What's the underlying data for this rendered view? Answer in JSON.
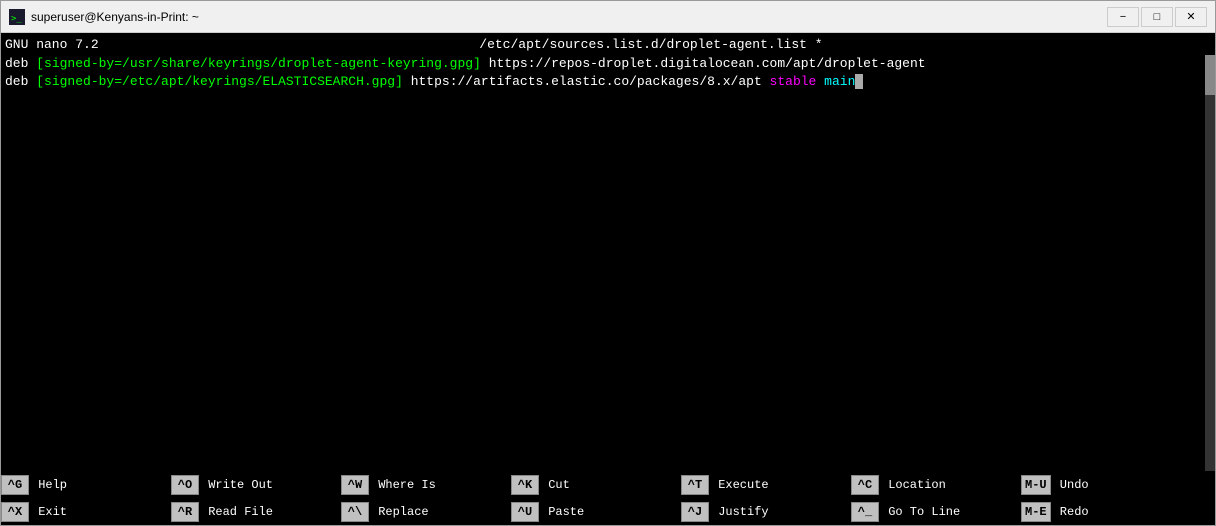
{
  "window": {
    "title": "superuser@Kenyans-in-Print: ~",
    "icon": "terminal-icon"
  },
  "titlebar": {
    "title_text": "superuser@Kenyans-in-Print: ~",
    "minimize_label": "−",
    "maximize_label": "□",
    "close_label": "✕"
  },
  "nano": {
    "header_left": "GNU nano 7.2",
    "header_center": "/etc/apt/sources.list.d/droplet-agent.list *",
    "line1_deb": "deb ",
    "line1_bracket": "[signed-by=/usr/share/keyrings/droplet-agent-keyring.gpg]",
    "line1_url": " https://repos-droplet.digitalocean.com/apt/droplet-agent",
    "line2_deb": "deb ",
    "line2_bracket": "[signed-by=/etc/apt/keyrings/ELASTICSEARCH.gpg]",
    "line2_url": " https://artifacts.elastic.co/packages/8.x/apt",
    "line2_stable": " stable",
    "line2_main": " main"
  },
  "shortcuts": {
    "row1": [
      {
        "key": "^G",
        "label": "Help"
      },
      {
        "key": "^O",
        "label": "Write Out"
      },
      {
        "key": "^W",
        "label": "Where Is"
      },
      {
        "key": "^K",
        "label": "Cut"
      },
      {
        "key": "^T",
        "label": "Execute"
      },
      {
        "key": "^C",
        "label": "Location"
      },
      {
        "key": "M-U",
        "label": "Undo"
      }
    ],
    "row2": [
      {
        "key": "^X",
        "label": "Exit"
      },
      {
        "key": "^R",
        "label": "Read File"
      },
      {
        "key": "^\\",
        "label": "Replace"
      },
      {
        "key": "^U",
        "label": "Paste"
      },
      {
        "key": "^J",
        "label": "Justify"
      },
      {
        "key": "^_",
        "label": "Go To Line"
      },
      {
        "key": "M-E",
        "label": "Redo"
      }
    ]
  }
}
